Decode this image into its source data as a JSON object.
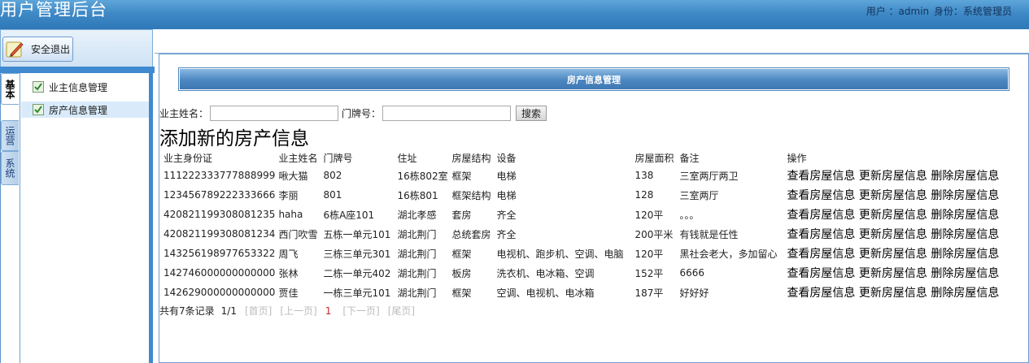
{
  "header": {
    "app_title": "用户管理后台",
    "user_label": "用户 ：admin",
    "role_label": "身份：系统管理员"
  },
  "sidebar": {
    "logout_label": "安全退出",
    "vertical_tabs": [
      "基本",
      "运营",
      "系统"
    ],
    "items": [
      {
        "label": "业主信息管理"
      },
      {
        "label": "房产信息管理"
      }
    ]
  },
  "main": {
    "panel_title": "房产信息管理",
    "search": {
      "owner_name_label": "业主姓名：",
      "owner_name_value": "",
      "door_no_label": "门牌号：",
      "door_no_value": "",
      "search_button": "搜索"
    },
    "add_link": "添加新的房产信息",
    "table": {
      "columns": [
        "业主身份证",
        "业主姓名",
        "门牌号",
        "住址",
        "房屋结构",
        "设备",
        "房屋面积",
        "备注",
        "操作"
      ],
      "rows": [
        {
          "id_card": "111222333777888999",
          "name": "啾大猫",
          "door": "802",
          "address": "16栋802室",
          "structure": "框架",
          "equipment": "电梯",
          "area": "138",
          "note": "三室两厅两卫"
        },
        {
          "id_card": "123456789222333666",
          "name": "李丽",
          "door": "801",
          "address": "16栋801",
          "structure": "框架结构",
          "equipment": "电梯",
          "area": "128",
          "note": "三室两厅"
        },
        {
          "id_card": "420821199308081235",
          "name": "haha",
          "door": "6栋A座101",
          "address": "湖北孝感",
          "structure": "套房",
          "equipment": "齐全",
          "area": "120平",
          "note": "。。。"
        },
        {
          "id_card": "420821199308081234",
          "name": "西门吹雪",
          "door": "五栋一单元101",
          "address": "湖北荆门",
          "structure": "总统套房",
          "equipment": "齐全",
          "area": "200平米",
          "note": "有钱就是任性"
        },
        {
          "id_card": "143256198977653322",
          "name": "周飞",
          "door": "三栋三单元301",
          "address": "湖北荆门",
          "structure": "框架",
          "equipment": "电视机、跑步机、空调、电脑",
          "area": "120平",
          "note": "黑社会老大，多加留心"
        },
        {
          "id_card": "142746000000000000",
          "name": "张林",
          "door": "二栋一单元402",
          "address": "湖北荆门",
          "structure": "板房",
          "equipment": "洗衣机、电冰箱、空调",
          "area": "152平",
          "note": "6666"
        },
        {
          "id_card": "142629000000000000",
          "name": "贾佳",
          "door": "一栋三单元101",
          "address": "湖北荆门",
          "structure": "框架",
          "equipment": "空调、电视机、电冰箱",
          "area": "187平",
          "note": "好好好"
        }
      ],
      "actions": {
        "view": "查看房屋信息",
        "update": "更新房屋信息",
        "delete": "删除房屋信息"
      }
    },
    "pager": {
      "summary": "共有7条记录",
      "page": "1/1",
      "first": "[首页]",
      "prev": "[上一页]",
      "current": "1",
      "next": "[下一页]",
      "last": "[尾页]"
    }
  },
  "colors": {
    "header_blue": "#3f89c6",
    "panel_blue": "#4c87c1",
    "current_page_red": "#c32b2b"
  }
}
